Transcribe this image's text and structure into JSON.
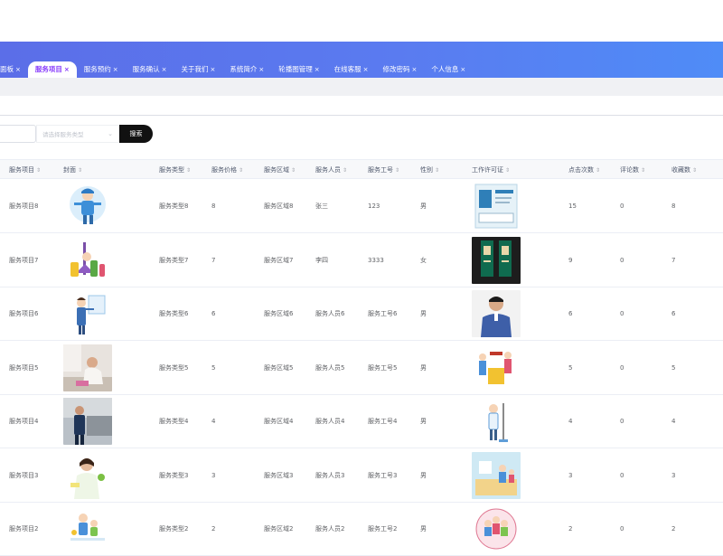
{
  "tabs": [
    {
      "label": "面板",
      "active": false
    },
    {
      "label": "服务项目",
      "active": true
    },
    {
      "label": "服务预约",
      "active": false
    },
    {
      "label": "服务确认",
      "active": false
    },
    {
      "label": "关于我们",
      "active": false
    },
    {
      "label": "系统简介",
      "active": false
    },
    {
      "label": "轮播图管理",
      "active": false
    },
    {
      "label": "在线客服",
      "active": false
    },
    {
      "label": "修改密码",
      "active": false
    },
    {
      "label": "个人信息",
      "active": false
    }
  ],
  "tab_close_glyph": "×",
  "filter": {
    "select_placeholder": "请选择服务类型",
    "search_label": "搜索"
  },
  "columns": {
    "item": "服务项目",
    "cover": "封面",
    "type": "服务类型",
    "price": "服务价格",
    "area": "服务区域",
    "staff": "服务人员",
    "staffno": "服务工号",
    "gender": "性别",
    "permit": "工作许可证",
    "clicks": "点击次数",
    "comments": "评论数",
    "favs": "收藏数"
  },
  "sort_glyph": "⇕",
  "rows": [
    {
      "item": "服务项目8",
      "type": "服务类型8",
      "price": "8",
      "area": "服务区域8",
      "staff": "张三",
      "staffno": "123",
      "gender": "男",
      "clicks": "15",
      "comments": "0",
      "favs": "8",
      "cover_icon": "cleaner-cartoon-icon",
      "permit_icon": "id-card-icon"
    },
    {
      "item": "服务项目7",
      "type": "服务类型7",
      "price": "7",
      "area": "服务区域7",
      "staff": "李四",
      "staffno": "3333",
      "gender": "女",
      "clicks": "9",
      "comments": "0",
      "favs": "7",
      "cover_icon": "cleaning-supplies-icon",
      "permit_icon": "badge-card-icon"
    },
    {
      "item": "服务项目6",
      "type": "服务类型6",
      "price": "6",
      "area": "服务区域6",
      "staff": "服务人员6",
      "staffno": "服务工号6",
      "gender": "男",
      "clicks": "6",
      "comments": "0",
      "favs": "6",
      "cover_icon": "window-cleaner-icon",
      "permit_icon": "worker-photo-icon"
    },
    {
      "item": "服务项目5",
      "type": "服务类型5",
      "price": "5",
      "area": "服务区域5",
      "staff": "服务人员5",
      "staffno": "服务工号5",
      "gender": "男",
      "clicks": "5",
      "comments": "0",
      "favs": "5",
      "cover_icon": "floor-cleaning-photo-icon",
      "permit_icon": "cleaning-crew-icon"
    },
    {
      "item": "服务项目4",
      "type": "服务类型4",
      "price": "4",
      "area": "服务区域4",
      "staff": "服务人员4",
      "staffno": "服务工号4",
      "gender": "男",
      "clicks": "4",
      "comments": "0",
      "favs": "4",
      "cover_icon": "sofa-cleaning-photo-icon",
      "permit_icon": "mop-worker-icon"
    },
    {
      "item": "服务项目3",
      "type": "服务类型3",
      "price": "3",
      "area": "服务区域3",
      "staff": "服务人员3",
      "staffno": "服务工号3",
      "gender": "男",
      "clicks": "3",
      "comments": "0",
      "favs": "3",
      "cover_icon": "housekeeper-photo-icon",
      "permit_icon": "kitchen-cleaning-icon"
    },
    {
      "item": "服务项目2",
      "type": "服务类型2",
      "price": "2",
      "area": "服务区域2",
      "staff": "服务人员2",
      "staffno": "服务工号2",
      "gender": "男",
      "clicks": "2",
      "comments": "0",
      "favs": "2",
      "cover_icon": "family-cleaning-icon",
      "permit_icon": "group-badge-icon"
    }
  ]
}
